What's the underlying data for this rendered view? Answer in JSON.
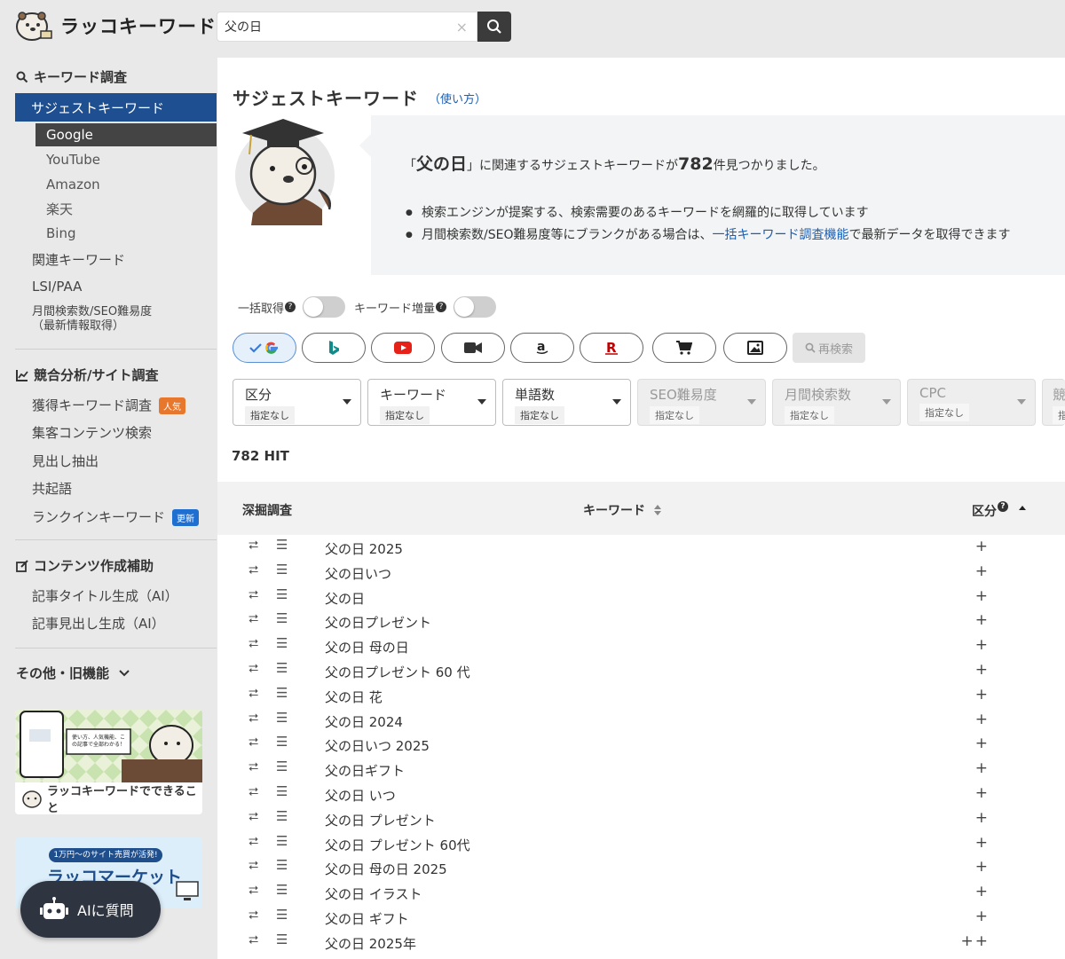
{
  "brand": {
    "name": "ラッコキーワード"
  },
  "search": {
    "value": "父の日",
    "clear": "×"
  },
  "sidebar": {
    "kw_research": "キーワード調査",
    "suggest": "サジェストキーワード",
    "suggest_subs": [
      "Google",
      "YouTube",
      "Amazon",
      "楽天",
      "Bing"
    ],
    "related": "関連キーワード",
    "lsi": "LSI/PAA",
    "monthly": "月間検索数/SEO難易度\n（最新情報取得）",
    "monthly_1": "月間検索数/SEO難易度",
    "monthly_2": "（最新情報取得）",
    "competitor": "競合分析/サイト調査",
    "acquired": "獲得キーワード調査",
    "badge_popular": "人気",
    "content_search": "集客コンテンツ検索",
    "headings": "見出し抽出",
    "cooccur": "共起語",
    "rankin": "ランクインキーワード",
    "badge_update": "更新",
    "content_support": "コンテンツ作成補助",
    "title_gen": "記事タイトル生成（AI）",
    "heading_gen": "記事見出し生成（AI）",
    "others": "その他・旧機能",
    "banner1_title": "ラッコキーワードでできること",
    "banner1_bubble": "使い方、人気機能、この記事で全部わかる！",
    "banner2_top": "1万円〜のサイト売買が活発!",
    "banner2_title": "ラッコマーケット",
    "ai_button": "AIに質問"
  },
  "main": {
    "title": "サジェストキーワード",
    "howto": "（使い方）",
    "result_pre": "「",
    "result_kw": "父の日",
    "result_mid": "」に関連するサジェストキーワードが",
    "result_count": "782",
    "result_post": "件見つかりました。",
    "bullet1": "検索エンジンが提案する、検索需要のあるキーワードを網羅的に取得しています",
    "bullet2_pre": "月間検索数/SEO難易度等にブランクがある場合は、",
    "bullet2_link": "一括キーワード調査機能",
    "bullet2_post": "で最新データを取得できます",
    "toggle1": "一括取得",
    "toggle2": "キーワード増量",
    "research": "再検索",
    "hit": "782 HIT",
    "filters": [
      {
        "title": "区分",
        "sub": "指定なし"
      },
      {
        "title": "キーワード",
        "sub": "指定なし"
      },
      {
        "title": "単語数",
        "sub": "指定なし"
      },
      {
        "title": "SEO難易度",
        "sub": "指定なし"
      },
      {
        "title": "月間検索数",
        "sub": "指定なし"
      },
      {
        "title": "CPC",
        "sub": "指定なし"
      },
      {
        "title": "競",
        "sub": "指"
      }
    ],
    "columns": {
      "dig": "深掘調査",
      "keyword": "キーワード",
      "category": "区分"
    },
    "rows": [
      {
        "kw": "父の日 2025",
        "cat": "+"
      },
      {
        "kw": "父の日いつ",
        "cat": "+"
      },
      {
        "kw": "父の日",
        "cat": "+"
      },
      {
        "kw": "父の日プレゼント",
        "cat": "+"
      },
      {
        "kw": "父の日 母の日",
        "cat": "+"
      },
      {
        "kw": "父の日プレゼント 60 代",
        "cat": "+"
      },
      {
        "kw": "父の日 花",
        "cat": "+"
      },
      {
        "kw": "父の日 2024",
        "cat": "+"
      },
      {
        "kw": "父の日いつ 2025",
        "cat": "+"
      },
      {
        "kw": "父の日ギフト",
        "cat": "+"
      },
      {
        "kw": "父の日 いつ",
        "cat": "+"
      },
      {
        "kw": "父の日 プレゼント",
        "cat": "+"
      },
      {
        "kw": "父の日 プレゼント 60代",
        "cat": "+"
      },
      {
        "kw": "父の日 母の日 2025",
        "cat": "+"
      },
      {
        "kw": "父の日 イラスト",
        "cat": "+"
      },
      {
        "kw": "父の日 ギフト",
        "cat": "+"
      },
      {
        "kw": "父の日 2025年",
        "cat": "++"
      }
    ]
  },
  "colors": {
    "accent": "#1d4f91",
    "link": "#1a5fb4",
    "badge_popular": "#e8772e",
    "badge_update": "#1f6fd1"
  }
}
